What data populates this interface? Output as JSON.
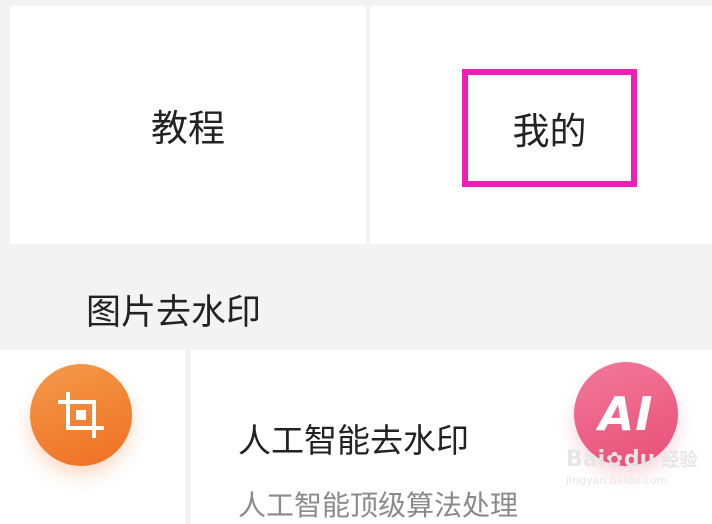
{
  "tabs": {
    "tutorial_label": "教程",
    "mine_label": "我的"
  },
  "section": {
    "title": "图片去水印"
  },
  "feature": {
    "title": "人工智能去水印",
    "description": "人工智能顶级算法处理",
    "badge_text": "AI"
  },
  "icons": {
    "crop": "crop-icon",
    "ai": "ai-badge-icon"
  },
  "watermark": {
    "brand_a": "Bai",
    "brand_b": "du",
    "brand_cn": "经验",
    "url": "jingyan.baidu.com"
  },
  "colors": {
    "highlight": "#ee1fb4",
    "crop_orange": "#ef7a2c",
    "ai_pink": "#ea5a80"
  }
}
